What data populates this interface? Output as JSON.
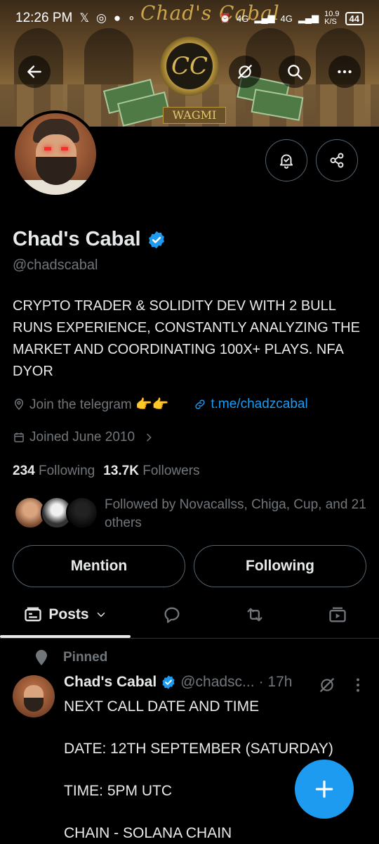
{
  "status_bar": {
    "time": "12:26 PM",
    "notification_icons": [
      "x-icon",
      "whatsapp-icon",
      "chat-icon",
      "dot-icon"
    ],
    "network_1": "4G",
    "network_2": "4G",
    "speed": "10.9",
    "speed_unit": "K/S",
    "battery": "44"
  },
  "banner": {
    "title": "Chad's Cabal",
    "logo_text": "CC",
    "tagline": "WAGMI"
  },
  "top_actions": [
    "back-arrow-icon",
    "grok-icon",
    "search-icon",
    "more-icon"
  ],
  "profile": {
    "name": "Chad's Cabal",
    "handle": "@chadscabal",
    "bio": "CRYPTO TRADER & SOLIDITY DEV WITH 2 BULL RUNS EXPERIENCE, CONSTANTLY ANALYZING THE MARKET AND COORDINATING 100X+ PLAYS. NFA DYOR",
    "location": "Join the telegram 👉👉",
    "website": "t.me/chadzcabal",
    "joined": "Joined June 2010",
    "following_count": "234",
    "following_label": "Following",
    "followers_count": "13.7K",
    "followers_label": "Followers",
    "followed_by": "Followed by Novacallss, Chiga, Cup, and 21 others"
  },
  "buttons": {
    "mention": "Mention",
    "following": "Following"
  },
  "tabs": {
    "posts": "Posts"
  },
  "pinned_post": {
    "pinned_label": "Pinned",
    "author": "Chad's Cabal",
    "handle": "@chadsc...",
    "time": "· 17h",
    "lines": [
      "NEXT CALL DATE AND TIME",
      "",
      "DATE: 12TH SEPTEMBER (SATURDAY)",
      "",
      "TIME: 5PM UTC",
      "",
      "CHAIN - SOLANA CHAIN"
    ]
  },
  "colors": {
    "accent": "#1d9bf0",
    "background": "#000000",
    "text_primary": "#e7e9ea",
    "text_secondary": "#71767b",
    "border": "#536471"
  }
}
